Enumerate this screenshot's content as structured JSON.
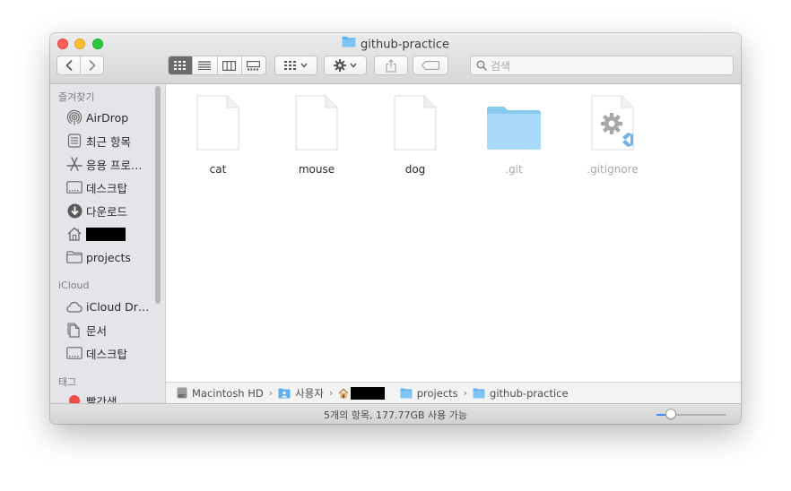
{
  "window": {
    "title": "github-practice"
  },
  "toolbar": {
    "back_icon": "chevron-left-icon",
    "forward_icon": "chevron-right-icon",
    "views": [
      "icon-view",
      "list-view",
      "column-view",
      "gallery-view"
    ],
    "active_view": "icon-view",
    "search_placeholder": "검색"
  },
  "sidebar": {
    "favorites_header": "즐겨찾기",
    "favorites": [
      {
        "label": "AirDrop",
        "icon": "airdrop-icon"
      },
      {
        "label": "최근 항목",
        "icon": "recents-icon"
      },
      {
        "label": "응용 프로…",
        "icon": "applications-icon"
      },
      {
        "label": "데스크탑",
        "icon": "desktop-icon"
      },
      {
        "label": "다운로드",
        "icon": "downloads-icon"
      },
      {
        "label": "",
        "icon": "home-icon"
      },
      {
        "label": "projects",
        "icon": "folder-icon"
      }
    ],
    "icloud_header": "iCloud",
    "icloud": [
      {
        "label": "iCloud Dr…",
        "icon": "cloud-icon"
      },
      {
        "label": "문서",
        "icon": "documents-icon"
      },
      {
        "label": "데스크탑",
        "icon": "desktop-icon"
      }
    ],
    "tags_header": "태그",
    "tags": [
      {
        "label": "빨간색",
        "color": "#f04e44"
      }
    ]
  },
  "files": [
    {
      "name": "cat",
      "kind": "document",
      "hidden": false
    },
    {
      "name": "mouse",
      "kind": "document",
      "hidden": false
    },
    {
      "name": "dog",
      "kind": "document",
      "hidden": false
    },
    {
      "name": ".git",
      "kind": "folder",
      "hidden": true
    },
    {
      "name": ".gitignore",
      "kind": "vscode-config",
      "hidden": true
    }
  ],
  "pathbar": {
    "crumbs": [
      {
        "label": "Macintosh HD",
        "icon": "hard-drive-icon"
      },
      {
        "label": "사용자",
        "icon": "users-folder-icon"
      },
      {
        "label": "",
        "icon": "home-icon"
      },
      {
        "label": "projects",
        "icon": "folder-icon"
      },
      {
        "label": "github-practice",
        "icon": "folder-icon"
      }
    ]
  },
  "status": {
    "text": "5개의 항목, 177.77GB 사용 가능",
    "icon_size_fraction": 0.2
  },
  "colors": {
    "accent": "#3f8cf5",
    "folder": "#8dcdf5",
    "tag_red": "#f04e44"
  }
}
